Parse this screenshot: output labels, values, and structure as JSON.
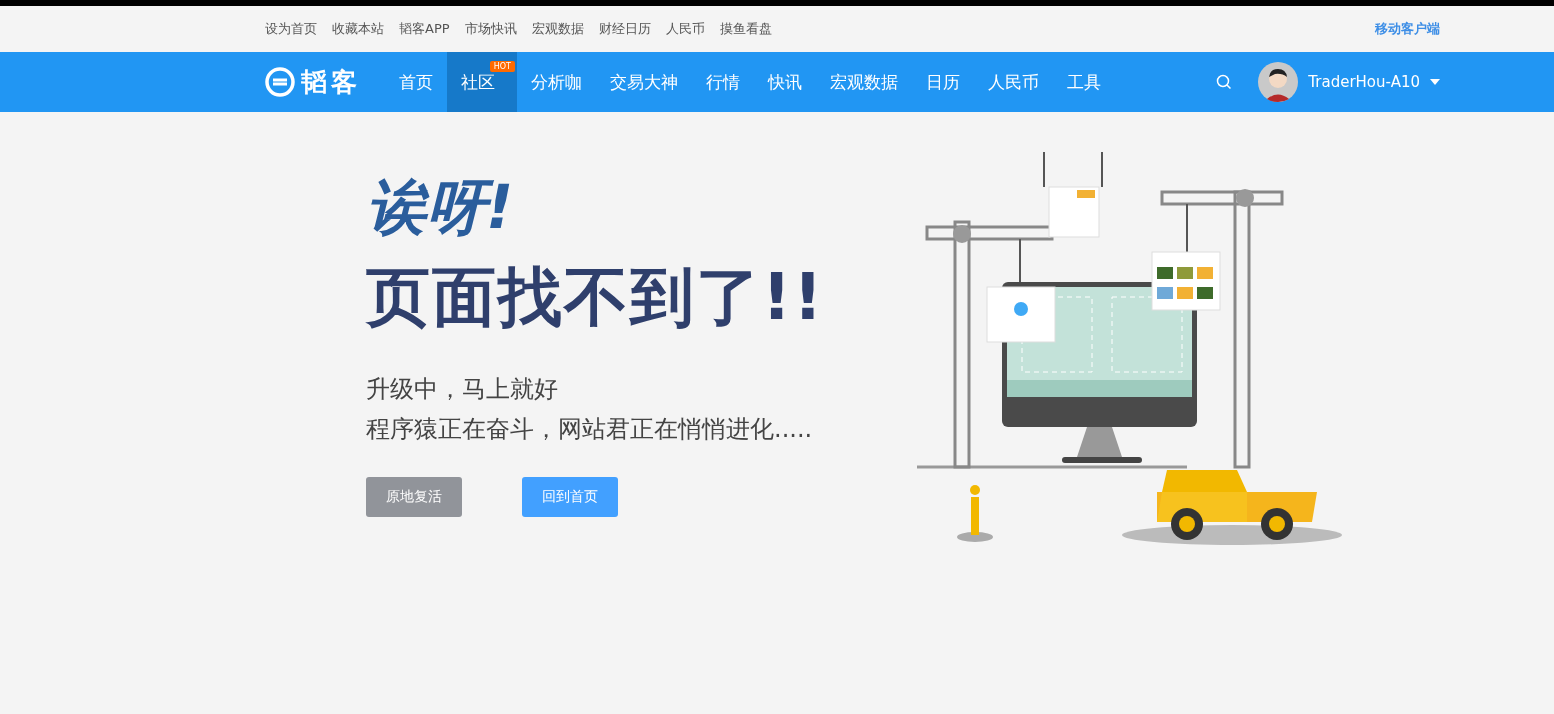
{
  "top_links": [
    "设为首页",
    "收藏本站",
    "韬客APP",
    "市场快讯",
    "宏观数据",
    "财经日历",
    "人民币",
    "摸鱼看盘"
  ],
  "mobile_link": "移动客户端",
  "logo": {
    "text": "韬客"
  },
  "nav": [
    {
      "label": "首页",
      "selected": false
    },
    {
      "label": "社区",
      "selected": true,
      "badge": "HOT"
    },
    {
      "label": "分析咖",
      "selected": false
    },
    {
      "label": "交易大神",
      "selected": false
    },
    {
      "label": "行情",
      "selected": false
    },
    {
      "label": "快讯",
      "selected": false
    },
    {
      "label": "宏观数据",
      "selected": false
    },
    {
      "label": "日历",
      "selected": false
    },
    {
      "label": "人民币",
      "selected": false
    },
    {
      "label": "工具",
      "selected": false
    }
  ],
  "user": {
    "name": "TraderHou-A10"
  },
  "error": {
    "title_1": "诶呀!",
    "title_2": "页面找不到了!!",
    "lines": [
      "升级中，马上就好",
      "程序猿正在奋斗，网站君正在悄悄进化....."
    ]
  },
  "buttons": [
    {
      "label": "原地复活",
      "kind": "secondary"
    },
    {
      "label": "回到首页",
      "kind": "primary"
    }
  ]
}
